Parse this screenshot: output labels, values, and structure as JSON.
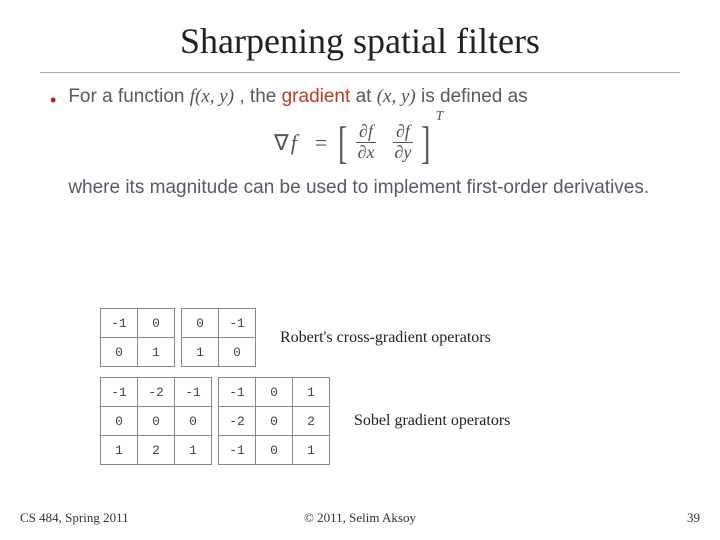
{
  "title": "Sharpening spatial filters",
  "bullet": {
    "part1": "For a function ",
    "func": "f(x, y)",
    "part2": ", the ",
    "keyword": "gradient",
    "part3": " at ",
    "point": "(x, y)",
    "part4": " is defined as"
  },
  "formula": {
    "nabla": "∇",
    "f": "f",
    "eq": "=",
    "lbr": "[",
    "d1_num": "∂f",
    "d1_den": "∂x",
    "d2_num": "∂f",
    "d2_den": "∂y",
    "rbr": "]",
    "T": "T"
  },
  "tail": "where its magnitude can be used to implement first-order derivatives.",
  "roberts": {
    "label": "Robert's cross-gradient operators",
    "k1": [
      [
        "-1",
        "0"
      ],
      [
        "0",
        "1"
      ]
    ],
    "k2": [
      [
        "0",
        "-1"
      ],
      [
        "1",
        "0"
      ]
    ]
  },
  "sobel": {
    "label": "Sobel gradient operators",
    "k1": [
      [
        "-1",
        "-2",
        "-1"
      ],
      [
        "0",
        "0",
        "0"
      ],
      [
        "1",
        "2",
        "1"
      ]
    ],
    "k2": [
      [
        "-1",
        "0",
        "1"
      ],
      [
        "-2",
        "0",
        "2"
      ],
      [
        "-1",
        "0",
        "1"
      ]
    ]
  },
  "footer": {
    "left": "CS 484, Spring 2011",
    "center": "© 2011, Selim Aksoy",
    "right": "39"
  }
}
